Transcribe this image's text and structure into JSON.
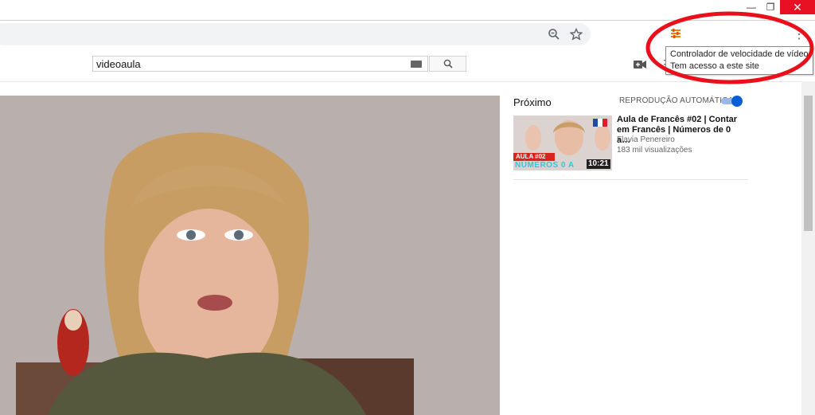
{
  "window": {
    "minimize_label": "—",
    "restore_label": "❐",
    "close_label": "✕"
  },
  "browser": {
    "zoom_icon": "zoom-icon",
    "star_icon": "star-icon",
    "extension_icon": "video-speed-controller-icon"
  },
  "tooltip": {
    "line1": "Controlador de velocidade de vídeo",
    "line2": "Tem acesso a este site"
  },
  "search": {
    "value": "videoaula"
  },
  "sidebar": {
    "next_label": "Próximo",
    "autoplay_label": "REPRODUÇÃO AUTOMÁTICA",
    "autoplay_on": true,
    "recommendation": {
      "title": "Aula de Francês #02 | Contar em Francês | Números de 0 a…",
      "channel": "Flavia Penereiro",
      "views": "183 mil visualizações",
      "duration": "10:21",
      "thumb_line1": "AULA #02",
      "thumb_line2": "NÚMEROS 0 A"
    }
  },
  "colors": {
    "accent_red": "#e8101a",
    "toggle_blue": "#065fd4",
    "extension_orange": "#f57c00"
  }
}
